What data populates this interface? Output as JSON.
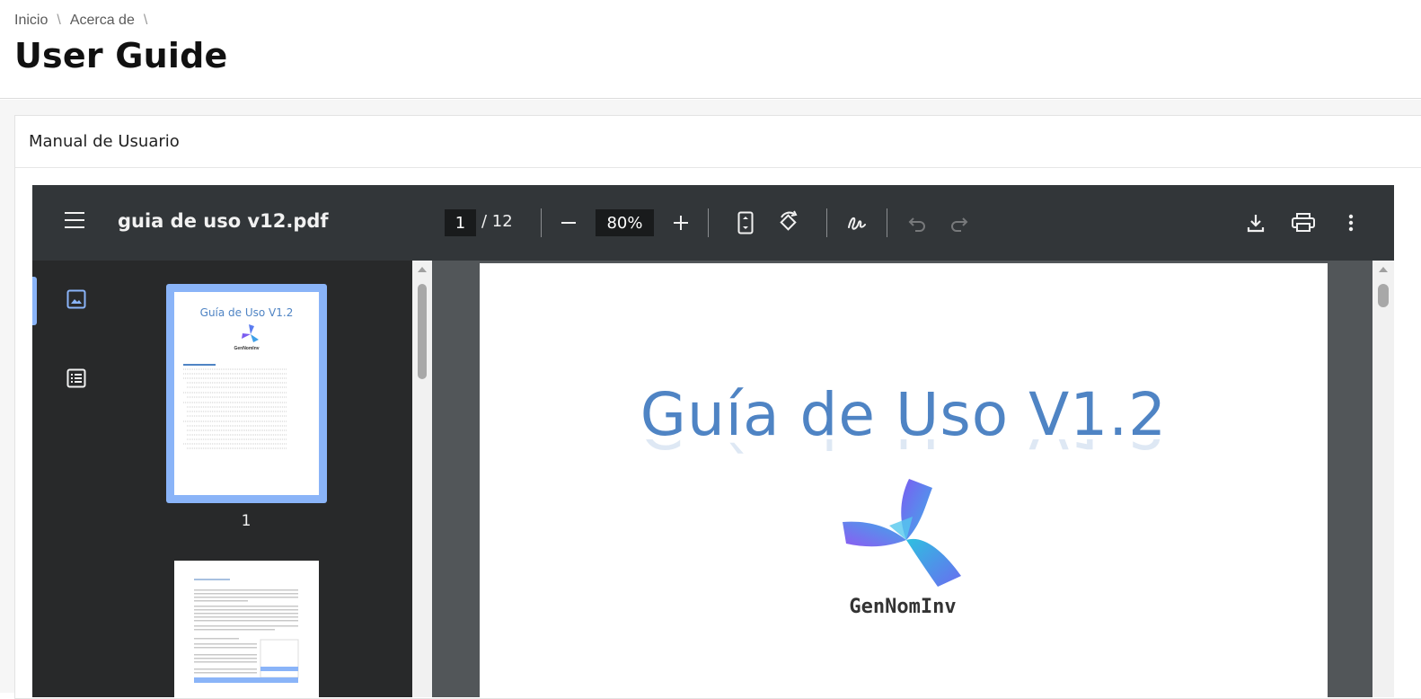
{
  "breadcrumb": {
    "items": [
      "Inicio",
      "Acerca de"
    ],
    "separator": "\\"
  },
  "page": {
    "title": "User Guide"
  },
  "card": {
    "title": "Manual de Usuario"
  },
  "viewer": {
    "filename": "guia de uso v12.pdf",
    "current_page": "1",
    "total_pages": "/ 12",
    "zoom": "80%",
    "icons": {
      "menu": "menu-icon",
      "zoom_out": "minus-icon",
      "zoom_in": "plus-icon",
      "fit": "fit-page-icon",
      "rotate": "rotate-icon",
      "annotate": "draw-icon",
      "undo": "undo-icon",
      "redo": "redo-icon",
      "download": "download-icon",
      "print": "print-icon",
      "more": "more-vert-icon"
    },
    "sidebar": {
      "tabs": [
        "thumbnails-icon",
        "outline-icon"
      ],
      "thumbnails": [
        {
          "label": "1",
          "title": "Guía de Uso V1.2",
          "logo": "GenNomInv"
        },
        {
          "label": ""
        }
      ]
    },
    "document": {
      "title": "Guía de Uso V1.2",
      "logo_text": "GenNomInv"
    }
  },
  "colors": {
    "accent": "#8ab4f8",
    "toolbar": "#323639",
    "viewer_bg": "#525659",
    "doc_title": "#4f84c4"
  }
}
